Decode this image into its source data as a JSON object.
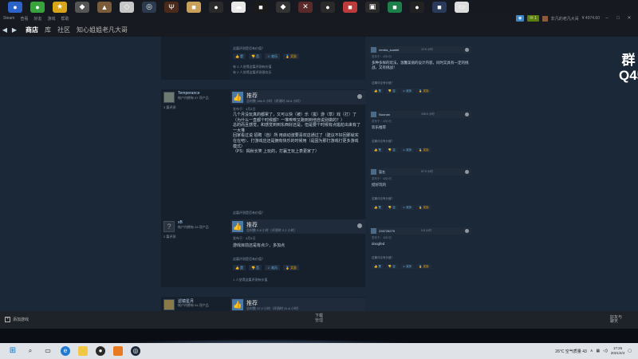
{
  "menubar": {
    "items": [
      "Steam",
      "查看",
      "好友",
      "游戏",
      "帮助"
    ],
    "user_label": "非凡的老凡大哥",
    "balance": "¥ 4974.60"
  },
  "nav": {
    "tabs": [
      "商店",
      "库",
      "社区"
    ],
    "active_tab": "商店",
    "username": "知心姐姐老凡大哥"
  },
  "reviews": [
    {
      "helpful_q": "这篇评测是否有价值？",
      "votes": {
        "yes": "是",
        "no": "否",
        "funny": "欢乐",
        "award": "奖励"
      },
      "stats": [
        "有 3 人觉得这篇评测有价值",
        "有 2 人觉得这篇评测很欢乐"
      ]
    },
    {
      "username": "Temperance",
      "user_stats": "帐户内拥有 57 项产品",
      "review_count": "3 篇评测",
      "rec": "推荐",
      "hours": "总时数 166.9 小时（评测时 38.5 小时）",
      "posted": "发布于：4月4日",
      "text": "几个月没玩真的都累了，又可以快（被）乐（拔）游（草）戏（打）了\n（为什么一直都个时候都？一堆唉唉又跑到到他自说别做的？）\n总的而且感觉，和感觉到到东西好还是，但是要个时候有点尴尬出来有了一大堆\n回家看过说 招聘（自）所 用启动波要喜欢这通过了（建议不好回那就实在在吧）、打游戏应还是拥有快乐的时候用（是因为那打游戏打更多游戏模式）\n（PS：揭秋长笑 上玩的，打赢王玩上表更家了）",
      "helpful_q": "这篇评测是否有价值？",
      "votes": {
        "yes": "是",
        "no": "否",
        "funny": "欢乐",
        "award": "奖励"
      },
      "stats": [
        "有 3 人觉得这篇评测有价值",
        "有 1 人觉得这篇评测很欢乐"
      ]
    },
    {
      "username": "xB",
      "user_stats": "帐户内拥有 26 项产品",
      "review_count": "2 篇评测",
      "rec": "推荐",
      "hours": "总时数 0.8 小时（评测时 0.2 小时）",
      "posted": "发布于：4月4日",
      "text": "游戏目前还是有点少，多加点",
      "helpful_q": "这篇评测是否有价值？",
      "votes": {
        "yes": "是",
        "no": "否",
        "funny": "欢乐",
        "award": "奖励"
      },
      "stats": [
        "1 人觉得这篇评测有价值"
      ]
    },
    {
      "username": "滤镜星月",
      "user_stats": "帐户内拥有 94 项产品",
      "rec": "推荐",
      "hours": "总时数 37.2 小时（评测时 31.6 小时）"
    }
  ],
  "comments": [
    {
      "name": "remba_scarlet",
      "date": "12.5 小时",
      "meta": "发布于：4月4日",
      "text": "多种多样的玩法，温馨美丽的设计内容，同时又具有一定的挑战，又有挑战！",
      "q": "这篇评论有价值？",
      "votes": {
        "yes": "是",
        "no": "否",
        "funny": "欢乐",
        "award": "奖励"
      }
    },
    {
      "name": "Nuonan",
      "date": "106.0 小时",
      "meta": "发布于：4月4日",
      "text": "欢乐推荐",
      "q": "这篇评论有价值？",
      "votes": {
        "yes": "是",
        "no": "否",
        "funny": "欢乐",
        "award": "奖励"
      }
    },
    {
      "name": "暂名",
      "date": "57.9 小时",
      "meta": "发布于：4月4日",
      "text": "挺好玩的",
      "q": "这篇评论有价值？",
      "votes": {
        "yes": "是",
        "no": "否",
        "funny": "欢乐",
        "award": "奖励"
      }
    },
    {
      "name": "226728279",
      "date": "0.8 小时",
      "meta": "发布于：4月4日",
      "text": "doogfed",
      "q": "这篇评论有价值？",
      "votes": {
        "yes": "是",
        "no": "否",
        "funny": "欢乐",
        "award": "奖励"
      }
    }
  ],
  "overlay": {
    "qq": "群Q454280982"
  },
  "bottombar": {
    "add_game": "添加游戏",
    "download": "下载",
    "download_sub": "管理",
    "friends": "好友与\n聊天"
  },
  "taskbar": {
    "weather": "26°C 空气质量 43",
    "time": "17:26",
    "date": "2021/4/4"
  }
}
